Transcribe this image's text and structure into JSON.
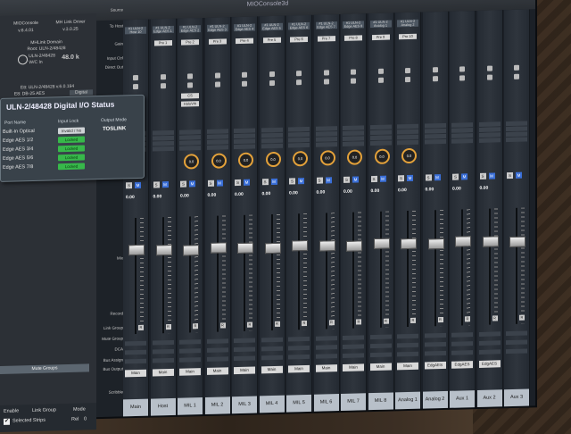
{
  "window": {
    "title": "MIOConsole3d"
  },
  "sidebar": {
    "app_name": "MIOConsole",
    "app_version": "v.6.4.01",
    "driver_name": "MH Link Driver",
    "driver_version": "v.3.0.25",
    "domain_label": "MHLink Domain",
    "domain_root": "Root: ULN-2/48428",
    "device_name": "ULN-2/48428",
    "word_clock_label": "W/C In",
    "sample_rate": "48.0 k",
    "device_line": "E8: ULN-2/48428 v.6.0.194",
    "ports_line": "E8: DB-25 AES",
    "tab_digital": "Digital",
    "mute_groups": "Mute Groups",
    "enable_label": "Enable",
    "link_group_label": "Link Group",
    "mode_label": "Mode",
    "selected_strips_label": "Selected Strips",
    "rel_label": "Rel",
    "rel_value": "0"
  },
  "io_status": {
    "title": "ULN-2/48428 Digital I/O Status",
    "col_port": "Port Name",
    "col_input": "Input Lock",
    "col_output": "Output Mode",
    "output_mode": "TOSLINK",
    "rows": [
      {
        "port": "Built-In Optical",
        "status": "Invalid / No Signal"
      },
      {
        "port": "Edge AES 1/2",
        "status": "Locked"
      },
      {
        "port": "Edge AES 3/4",
        "status": "Locked"
      },
      {
        "port": "Edge AES 5/6",
        "status": "Locked"
      },
      {
        "port": "Edge AES 7/8",
        "status": "Locked"
      }
    ]
  },
  "row_labels": {
    "source": "Source",
    "to_host": "To Host",
    "gain": "Gain",
    "input_ctrl": "Input Ctrl",
    "direct_out": "Direct Out",
    "solo_mute": "Solo/Mute",
    "mix": "Mix",
    "record": "Record",
    "link_group": "Link Group",
    "mute_group": "Mute Group",
    "dca": "DCA",
    "bus_assign": "Bus Assign",
    "bus_output": "Bus Output",
    "scribble": "Scribble"
  },
  "strips": [
    {
      "name": "Main",
      "source": "#1 ULN-2 Host 10",
      "pre": "",
      "pan": "",
      "value": "0.00",
      "bus_output": "Main"
    },
    {
      "name": "Host",
      "source": "#1 ULN-2 Edge AES 1",
      "pre": "Pre 1",
      "pan": "",
      "value": "0.00",
      "bus_output": "Main"
    },
    {
      "name": "MIL 1",
      "source": "#1 ULN-2 Edge AES 2",
      "pre": "Pre 2",
      "pan": "0.0",
      "value": "0.00",
      "bus_output": "Main"
    },
    {
      "name": "MIL 2",
      "source": "#1 ULN-2 Edge AES 3",
      "pre": "Pre 3",
      "pan": "0.0",
      "value": "0.00",
      "bus_output": "Main"
    },
    {
      "name": "MIL 3",
      "source": "#1 ULN-2 Edge AES 4",
      "pre": "Pre 4",
      "pan": "0.0",
      "value": "0.00",
      "bus_output": "Main"
    },
    {
      "name": "MIL 4",
      "source": "#1 ULN-2 Edge AES 5",
      "pre": "Pre 5",
      "pan": "0.0",
      "value": "0.00",
      "bus_output": "Main"
    },
    {
      "name": "MIL 5",
      "source": "#1 ULN-2 Edge AES 6",
      "pre": "Pre 6",
      "pan": "0.0",
      "value": "0.00",
      "bus_output": "Main"
    },
    {
      "name": "MIL 6",
      "source": "#1 ULN-2 Edge AES 7",
      "pre": "Pre 7",
      "pan": "0.0",
      "value": "0.00",
      "bus_output": "Main"
    },
    {
      "name": "MIL 7",
      "source": "#1 ULN-2 Edge AES 8",
      "pre": "Pre 8",
      "pan": "0.0",
      "value": "0.00",
      "bus_output": "Main"
    },
    {
      "name": "MIL 8",
      "source": "#1 ULN-2 Analog 1",
      "pre": "Pre 9",
      "pan": "0.0",
      "value": "0.00",
      "bus_output": "Main"
    },
    {
      "name": "Analog 1",
      "source": "#1 ULN-2 Analog 2",
      "pre": "Pre 10",
      "pan": "0.0",
      "value": "0.00",
      "bus_output": "Main"
    },
    {
      "name": "Analog 2",
      "source": "",
      "pre": "",
      "pan": "",
      "value": "0.00",
      "bus_output": "EdgAES"
    },
    {
      "name": "Aux 1",
      "source": "",
      "pre": "",
      "pan": "",
      "value": "0.00",
      "bus_output": "EdgAES"
    },
    {
      "name": "Aux 2",
      "source": "",
      "pre": "",
      "pan": "",
      "value": "0.00",
      "bus_output": "EdgAES"
    },
    {
      "name": "Aux 3",
      "source": "",
      "pre": "",
      "pan": "",
      "value": "",
      "bus_output": ""
    }
  ],
  "insert": {
    "cs_label": "CS",
    "plugin_label": "HaloVrb"
  },
  "button_letters": {
    "solo": "S",
    "mute": "M",
    "record": "R"
  },
  "colors": {
    "knob_ring": "#e3a13a",
    "mute_active": "#3a6fd8",
    "locked": "#37b84a"
  }
}
